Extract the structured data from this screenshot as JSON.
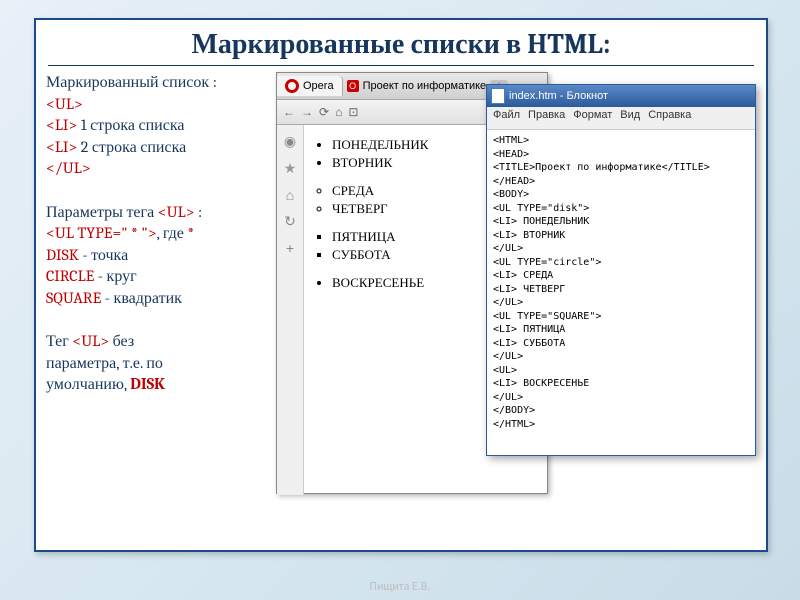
{
  "slide": {
    "title": "Маркированные списки в HTML:",
    "left": {
      "line1": "Маркированный список :",
      "tag1": "<UL>",
      "tag2a": "<LI>",
      "tag2b": " 1 строка списка",
      "tag3a": "<LI>",
      "tag3b": " 2 строка списка",
      "tag4": "</UL>",
      "params1a": "Параметры тега ",
      "params1b": "<UL>",
      "params1c": " :",
      "params2a": "<UL  TYPE=\" * \">",
      "params2b": ", где ",
      "params2c": "*",
      "disk1": "DISK",
      "disk2": "  - точка",
      "circle1": "CIRCLE",
      "circle2": "  - круг",
      "square1": "SQUARE",
      "square2": "  - квадратик",
      "tail1a": "Тег ",
      "tail1b": "<UL>",
      "tail1c": "  без",
      "tail2": "параметра, т.е. по",
      "tail3a": "умолчанию, ",
      "tail3b": "DISK"
    }
  },
  "browser": {
    "app_label": "Opera",
    "tab_title": "Проект по информатике",
    "toolbar": {
      "back": "←",
      "fwd": "→",
      "reload": "⟳",
      "home": "⌂",
      "bookmark_bar": "⊡"
    },
    "sidebar_icons": [
      "◉",
      "★",
      "⌂",
      "↻",
      "+"
    ],
    "lists": {
      "disc": [
        "ПОНЕДЕЛЬНИК",
        "ВТОРНИК"
      ],
      "circle": [
        "СРЕДА",
        "ЧЕТВЕРГ"
      ],
      "square": [
        "ПЯТНИЦА",
        "СУББОТА"
      ],
      "default": [
        "ВОСКРЕСЕНЬЕ"
      ]
    }
  },
  "notepad": {
    "title": "index.htm - Блокнот",
    "menu": [
      "Файл",
      "Правка",
      "Формат",
      "Вид",
      "Справка"
    ],
    "code": "<HTML>\n<HEAD>\n<TITLE>Проект по информатике</TITLE>\n</HEAD>\n<BODY>\n<UL TYPE=\"disk\">\n<LI> ПОНЕДЕЛЬНИК\n<LI> ВТОРНИК\n</UL>\n<UL TYPE=\"circle\">\n<LI> СРЕДА\n<LI> ЧЕТВЕРГ\n</UL>\n<UL TYPE=\"SQUARE\">\n<LI> ПЯТНИЦА\n<LI> СУББОТА\n</UL>\n<UL>\n<LI> ВОСКРЕСЕНЬЕ\n</UL>\n</BODY>\n</HTML>"
  },
  "footer": "Пищита Е.В."
}
